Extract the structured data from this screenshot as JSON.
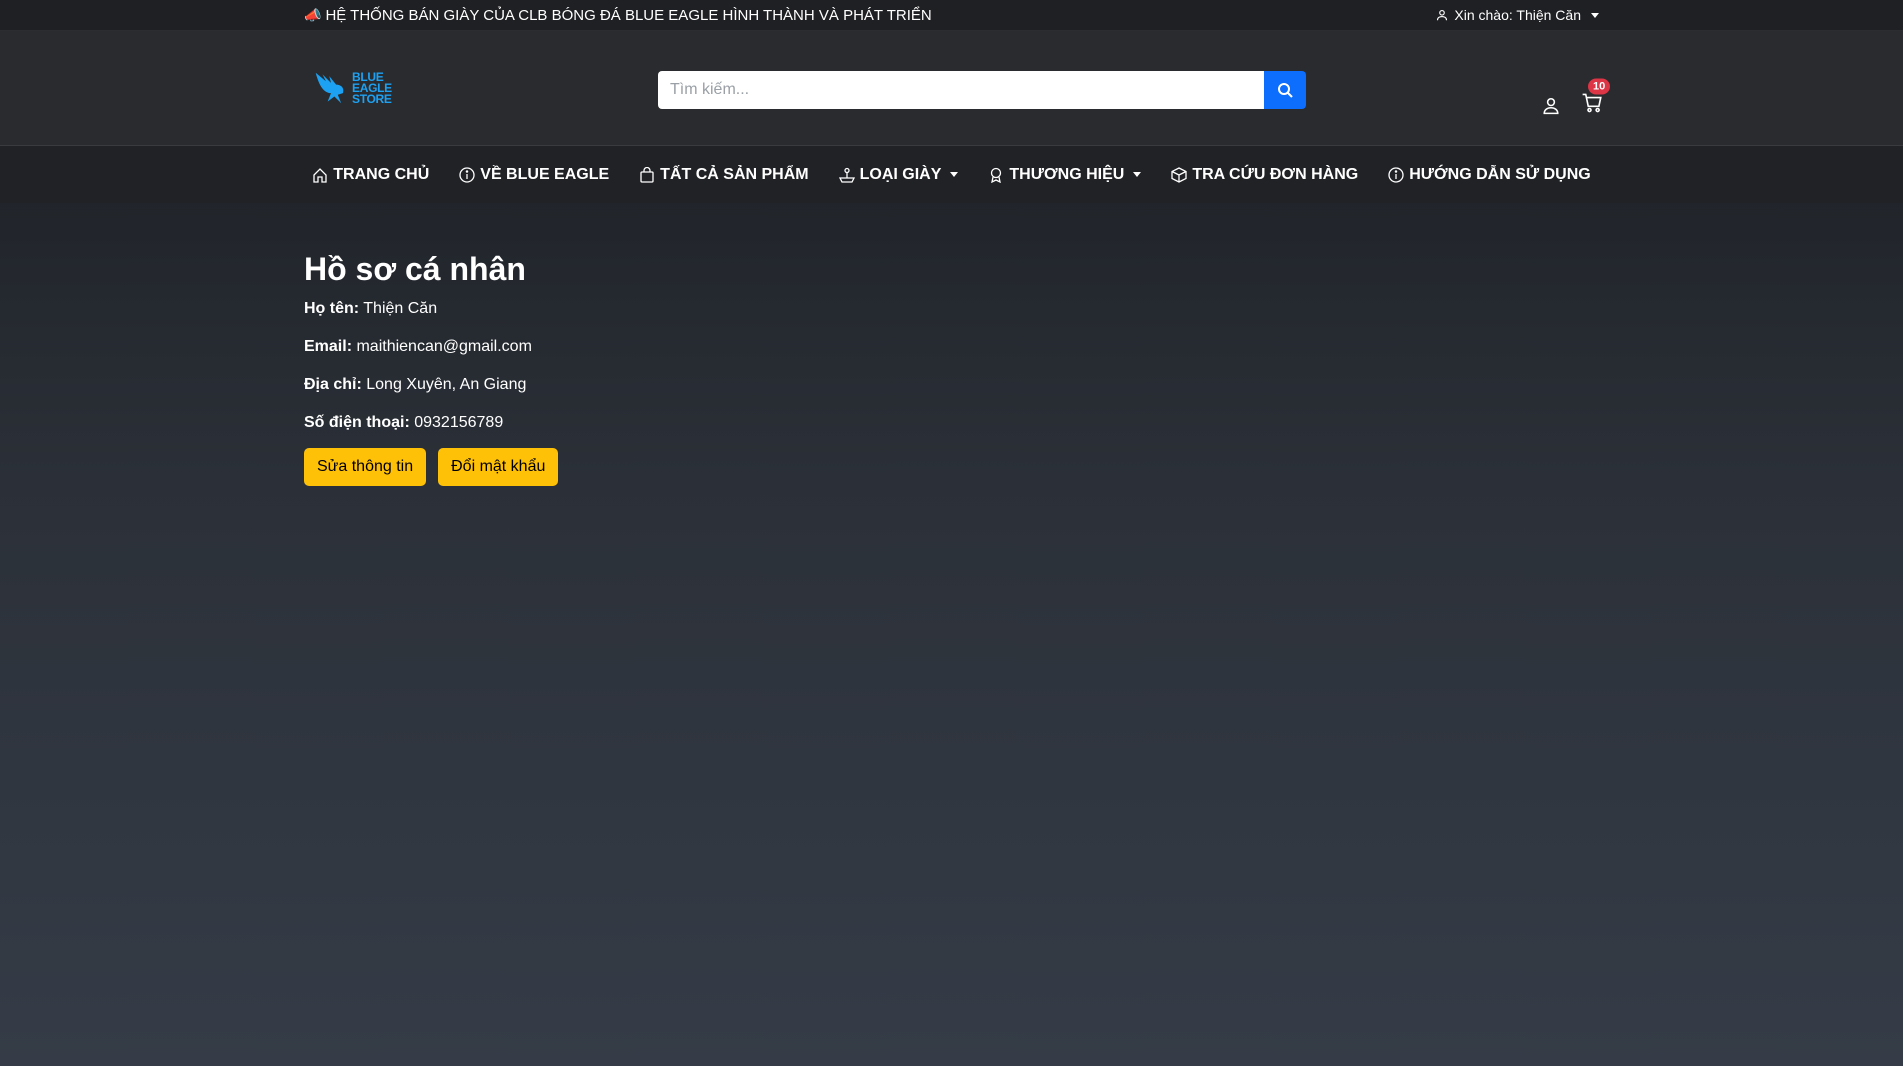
{
  "topbar": {
    "announcement": "HỆ THỐNG BÁN GIÀY CỦA CLB BÓNG ĐÁ BLUE EAGLE HÌNH THÀNH VÀ PHÁT TRIỂN",
    "greeting": "Xin chào: Thiện Căn"
  },
  "logo": {
    "line1": "BLUE",
    "line2": "EAGLE",
    "line3": "STORE"
  },
  "search": {
    "placeholder": "Tìm kiếm..."
  },
  "cart": {
    "count": "10"
  },
  "nav": {
    "items": [
      {
        "label": "TRANG CHỦ",
        "icon": "home-icon"
      },
      {
        "label": "VỀ BLUE EAGLE",
        "icon": "info-icon"
      },
      {
        "label": "TẤT CẢ SẢN PHẨM",
        "icon": "bag-icon"
      },
      {
        "label": "LOẠI GIÀY",
        "icon": "joystick-icon",
        "dropdown": true
      },
      {
        "label": "THƯƠNG HIỆU",
        "icon": "award-icon",
        "dropdown": true
      },
      {
        "label": "TRA CỨU ĐƠN HÀNG",
        "icon": "box-icon"
      },
      {
        "label": "HƯỚNG DẪN SỬ DỤNG",
        "icon": "info-icon"
      }
    ]
  },
  "profile": {
    "title": "Hồ sơ cá nhân",
    "name_label": "Họ tên:",
    "name": "Thiện Căn",
    "email_label": "Email:",
    "email": "maithiencan@gmail.com",
    "address_label": "Địa chỉ:",
    "address": "Long Xuyên, An Giang",
    "phone_label": "Số điện thoại:",
    "phone": "0932156789",
    "edit_button": "Sửa thông tin",
    "password_button": "Đổi mật khẩu"
  },
  "colors": {
    "accent": "#ffc107",
    "primary": "#0d6efd",
    "badge": "#dc3545"
  }
}
